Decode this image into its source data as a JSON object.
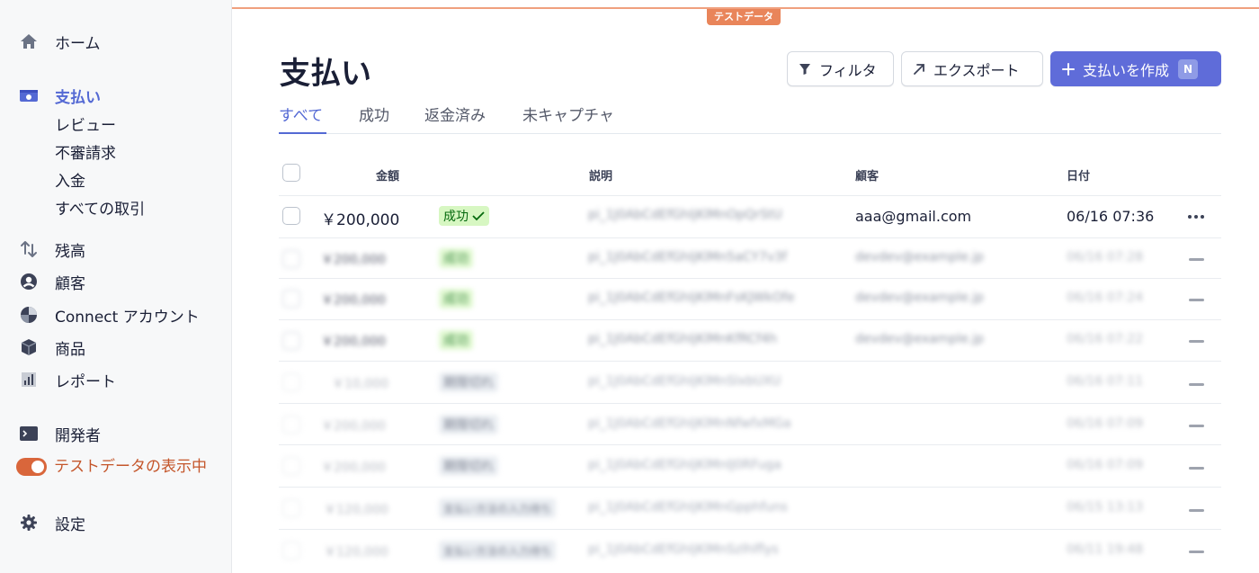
{
  "sidebar": {
    "home": "ホーム",
    "payments": "支払い",
    "sub": [
      "レビュー",
      "不審請求",
      "入金",
      "すべての取引"
    ],
    "balance": "残高",
    "customers": "顧客",
    "connect": "Connect アカウント",
    "products": "商品",
    "reports": "レポート",
    "developers": "開発者",
    "test_mode": "テストデータの表示中",
    "settings": "設定"
  },
  "test_badge": "テストデータ",
  "page_title": "支払い",
  "toolbar": {
    "filter": "フィルタ",
    "export": "エクスポート",
    "create": "支払いを作成",
    "shortcut": "N"
  },
  "tabs": [
    "すべて",
    "成功",
    "返金済み",
    "未キャプチャ"
  ],
  "table": {
    "headers": {
      "amount": "金額",
      "description": "説明",
      "customer": "顧客",
      "date": "日付"
    },
    "rows": [
      {
        "amount": "￥200,000",
        "status": "成功",
        "description": "pi_1J0AbCdEfGhIjKlMnOpQrStU",
        "customer": "aaa@gmail.com",
        "date": "06/16 07:36"
      },
      {
        "amount": "￥200,000",
        "status": "成功",
        "description": "pi_1J0AbCdEfGhIjKlMn5aCY7v3f",
        "customer": "devdev@example.jp",
        "date": "06/16 07:28"
      },
      {
        "amount": "￥200,000",
        "status": "成功",
        "description": "pi_1J0AbCdEfGhIjKlMnFsKJWkOfe",
        "customer": "devdev@example.jp",
        "date": "06/16 07:24"
      },
      {
        "amount": "￥200,000",
        "status": "成功",
        "description": "pi_1J0AbCdEfGhIjKlMnKfRCf4h",
        "customer": "devdev@example.jp",
        "date": "06/16 07:22"
      },
      {
        "amount": "￥10,000",
        "status": "期限切れ",
        "description": "pi_1J0AbCdEfGhIjKlMnSlxbUXU",
        "customer": "",
        "date": "06/16 07:11"
      },
      {
        "amount": "￥200,000",
        "status": "期限切れ",
        "description": "pi_1J0AbCdEfGhIjKlMnNfwfxMGa",
        "customer": "",
        "date": "06/16 07:09"
      },
      {
        "amount": "￥200,000",
        "status": "期限切れ",
        "description": "pi_1J0AbCdEfGhIjKlMnIJ0RFuga",
        "customer": "",
        "date": "06/16 07:09"
      },
      {
        "amount": "￥120,000",
        "status": "支払い方法の入力待ち",
        "description": "pi_1J0AbCdEfGhIjKlMnGpphfuns",
        "customer": "",
        "date": "06/15 13:13"
      },
      {
        "amount": "￥120,000",
        "status": "支払い方法の入力待ち",
        "description": "pi_1J0AbCdEfGhIjKlMnSzlhlflys",
        "customer": "",
        "date": "06/11 19:48"
      }
    ]
  },
  "colors": {
    "accent": "#5469d4",
    "primary_button": "#5f6cd9",
    "test_mode": "#d9663b",
    "success_bg": "#d7f7c2"
  }
}
